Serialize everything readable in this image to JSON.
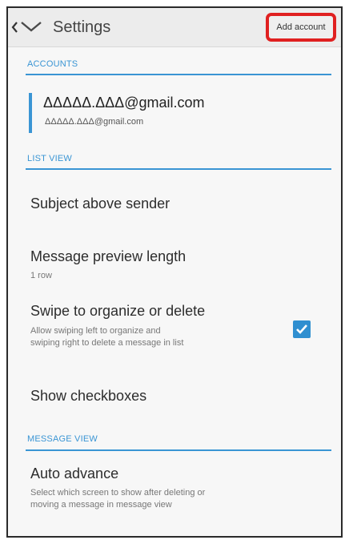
{
  "header": {
    "title": "Settings",
    "add_account_label": "Add account"
  },
  "sections": {
    "accounts": "ACCOUNTS",
    "list_view": "LIST VIEW",
    "message_view": "MESSAGE VIEW"
  },
  "account": {
    "email": "ΔΔΔΔΔ.ΔΔΔ@gmail.com",
    "email_sub": "ΔΔΔΔΔ.ΔΔΔ@gmail.com"
  },
  "list_view": {
    "subject_above_sender": "Subject above sender",
    "preview_length_title": "Message preview length",
    "preview_length_value": "1 row",
    "swipe_title": "Swipe to organize or delete",
    "swipe_desc_1": "Allow swiping left to organize and",
    "swipe_desc_2": "swiping right to delete a message in list",
    "swipe_checked": true,
    "show_checkboxes": "Show checkboxes"
  },
  "message_view": {
    "auto_advance_title": "Auto advance",
    "auto_advance_desc_1": "Select which screen to show after deleting or",
    "auto_advance_desc_2": "moving a message in message view"
  },
  "colors": {
    "accent": "#3a95d4",
    "highlight": "#e02020"
  }
}
